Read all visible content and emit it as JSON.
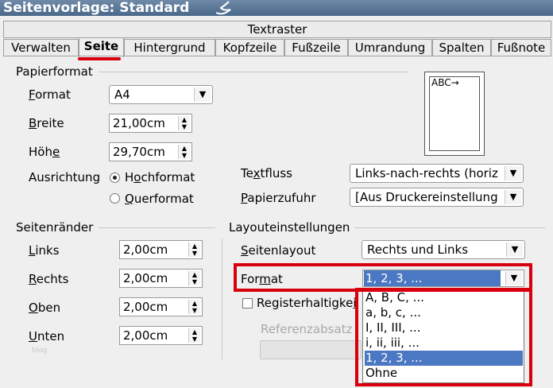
{
  "window": {
    "title": "Seitenvorlage: Standard"
  },
  "tabs_back": {
    "label": "Textraster"
  },
  "tabs": [
    {
      "label": "Verwalten"
    },
    {
      "label": "Seite"
    },
    {
      "label": "Hintergrund"
    },
    {
      "label": "Kopfzeile"
    },
    {
      "label": "Fußzeile"
    },
    {
      "label": "Umrandung"
    },
    {
      "label": "Spalten"
    },
    {
      "label": "Fußnote"
    }
  ],
  "paper": {
    "section_title": "Papierformat",
    "format_label_pre": "F",
    "format_label_rest": "ormat",
    "format_value": "A4",
    "width_label_pre": "B",
    "width_label_rest": "reite",
    "width_value": "21,00cm",
    "height_label_pre": "Höh",
    "height_label_u": "e",
    "height_value": "29,70cm",
    "orientation_label": "Ausrichtung",
    "portrait_pre": "H",
    "portrait_u": "o",
    "portrait_rest": "chformat",
    "landscape_u": "Q",
    "landscape_rest": "uerformat",
    "textflow_pre": "Te",
    "textflow_u": "x",
    "textflow_rest": "tfluss",
    "textflow_value": "Links-nach-rechts (horiz",
    "paperfeed_u": "P",
    "paperfeed_rest": "apierzufuhr",
    "paperfeed_value": "[Aus Druckereinstellung",
    "preview_text": "ABC→"
  },
  "margins": {
    "section_title": "Seitenränder",
    "left_u": "L",
    "left_rest": "inks",
    "left_value": "2,00cm",
    "right_u": "R",
    "right_rest": "echts",
    "right_value": "2,00cm",
    "top_u": "O",
    "top_rest": "ben",
    "top_value": "2,00cm",
    "bottom_u": "U",
    "bottom_rest": "nten",
    "bottom_value": "2,00cm",
    "watermark": "blog"
  },
  "layout": {
    "section_title": "Layouteinstellungen",
    "pagelayout_u": "S",
    "pagelayout_rest": "eitenlayout",
    "pagelayout_value": "Rechts und Links",
    "format_pre": "For",
    "format_u": "m",
    "format_rest": "at",
    "format_value": "1, 2, 3, ...",
    "register_label": "Registerhaltigke",
    "register_u": "i",
    "reference_label": "Referenzabsatz",
    "format_options": [
      "A, B, C, ...",
      "a, b, c, ...",
      "I, II, III, ...",
      "i, ii, iii, ...",
      "1, 2, 3, ...",
      "Ohne"
    ]
  },
  "colors": {
    "highlight": "#d8000c",
    "selection": "#4a78c2",
    "titlebar": "#4a6889"
  }
}
